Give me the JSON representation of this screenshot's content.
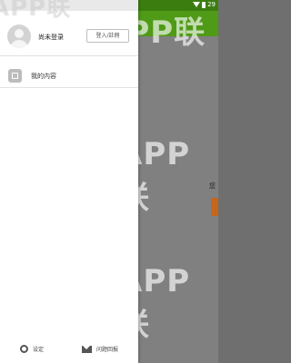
{
  "status": {
    "time": "29"
  },
  "profile": {
    "username": "尚未登录",
    "login_label": "登入/註冊"
  },
  "menu": {
    "items": [
      {
        "label": "我的内容"
      }
    ]
  },
  "footer": {
    "settings_label": "设定",
    "feedback_label": "问题回报"
  },
  "background": {
    "text": "您"
  },
  "watermark": {
    "text": "APP联"
  },
  "colors": {
    "toolbar": "#4f9a17",
    "statusbar": "#3c7d10",
    "accent": "#c7651a"
  },
  "icons": {
    "avatar": "avatar",
    "menu": "content-icon",
    "settings": "gear-icon",
    "feedback": "mail-icon"
  }
}
